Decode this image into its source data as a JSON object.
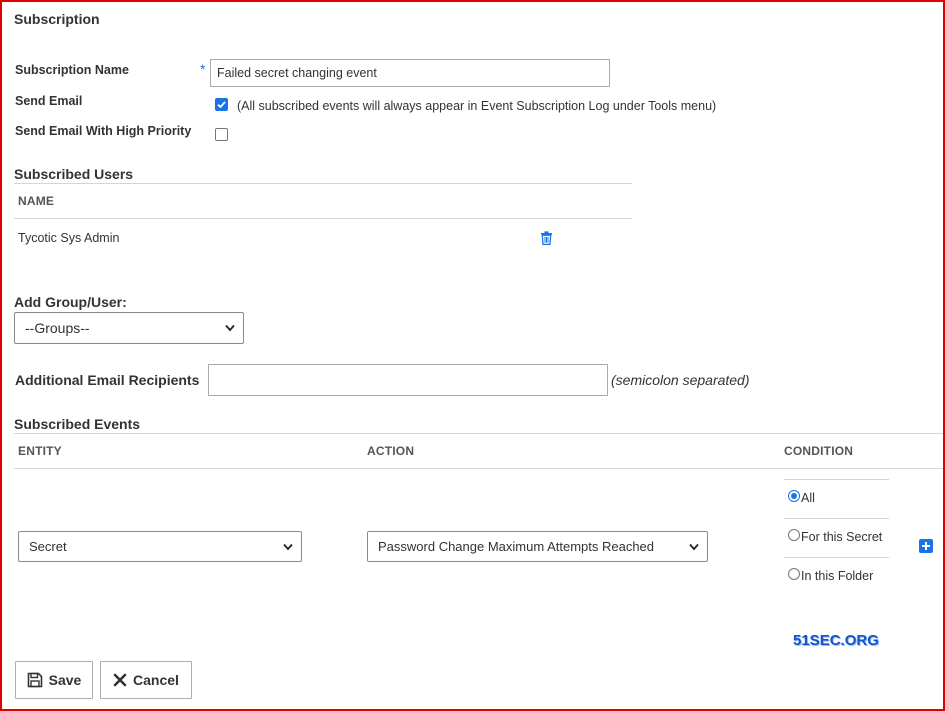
{
  "page": {
    "title": "Subscription"
  },
  "form": {
    "name_label": "Subscription Name",
    "required_mark": "*",
    "name_value": "Failed secret changing event",
    "send_email_label": "Send Email",
    "send_email_checked": true,
    "send_email_note": "(All subscribed events will always appear in Event Subscription Log under Tools menu)",
    "high_priority_label": "Send Email With High Priority",
    "high_priority_checked": false
  },
  "subscribed_users": {
    "title": "Subscribed Users",
    "column_name": "NAME",
    "rows": [
      {
        "name": "Tycotic Sys Admin"
      }
    ]
  },
  "add_group_user": {
    "label": "Add Group/User:",
    "selected": "--Groups--"
  },
  "additional_recipients": {
    "label": "Additional Email Recipients",
    "value": "",
    "hint": "(semicolon separated)"
  },
  "subscribed_events": {
    "title": "Subscribed Events",
    "columns": {
      "entity": "ENTITY",
      "action": "ACTION",
      "condition": "CONDITION"
    },
    "row": {
      "entity": "Secret",
      "action": "Password Change Maximum Attempts Reached",
      "conditions": [
        {
          "label": "All",
          "selected": true
        },
        {
          "label": "For this Secret",
          "selected": false
        },
        {
          "label": "In this Folder",
          "selected": false
        }
      ]
    }
  },
  "watermark": "51SEC.ORG",
  "buttons": {
    "save": "Save",
    "cancel": "Cancel"
  },
  "colors": {
    "accent": "#1a73e8",
    "border": "#e00000",
    "watermark": "#1155cc"
  }
}
